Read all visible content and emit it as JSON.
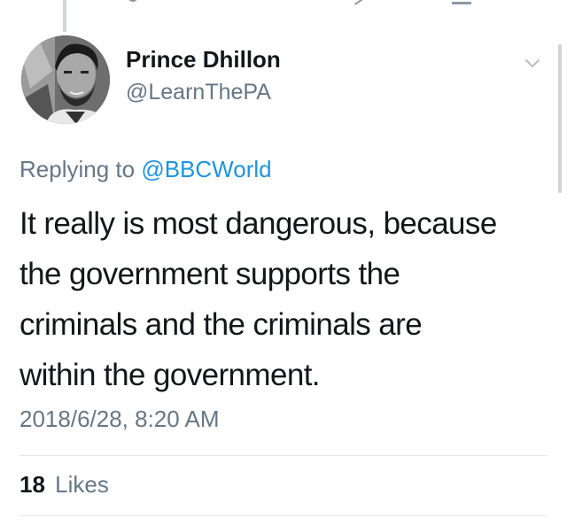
{
  "tweet": {
    "author_name": "Prince Dhillon",
    "author_handle": "@LearnThePA",
    "replying_prefix": "Replying to",
    "replying_to": "@BBCWorld",
    "text_lines": [
      "It really is most dangerous, because",
      "the government supports the",
      "criminals and the criminals are",
      "within the government."
    ],
    "timestamp": "2018/6/28, 8:20 AM",
    "likes_count": "18",
    "likes_label": "Likes"
  },
  "icons": {
    "more": "chevron-down-icon",
    "avatar": "avatar"
  },
  "colors": {
    "text": "#14171a",
    "secondary": "#657786",
    "link": "#1b95e0",
    "divider": "#e1e8ed"
  }
}
